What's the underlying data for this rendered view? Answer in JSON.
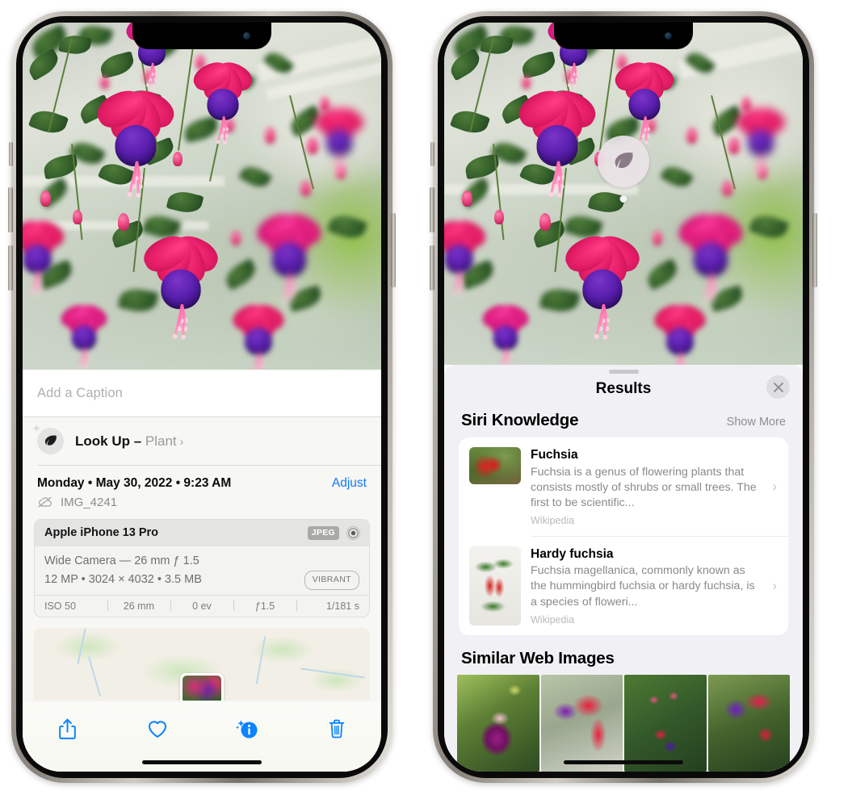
{
  "left_phone": {
    "name": "iphone-photo-info",
    "photo_alt": "Fuchsia flowers hanging basket",
    "caption": {
      "placeholder": "Add a Caption",
      "value": ""
    },
    "lookup": {
      "icon": "leaf-icon",
      "sparkle_icon": "sparkle-icon",
      "label": "Look Up",
      "dash": " – ",
      "subject": "Plant",
      "chevron": "›"
    },
    "date": {
      "text": "Monday • May 30, 2022 • 9:23 AM",
      "adjust_label": "Adjust"
    },
    "file": {
      "cloud_icon": "cloud-slash-icon",
      "name": "IMG_4241"
    },
    "exif": {
      "device": "Apple iPhone 13 Pro",
      "format_badge": "JPEG",
      "aperture_icon": "aperture-icon",
      "lens_line": "Wide Camera — 26 mm ƒ 1.5",
      "size_line": "12 MP • 3024 × 4032 • 3.5 MB",
      "quality_chip": "VIBRANT",
      "stats": [
        "ISO 50",
        "26 mm",
        "0 ev",
        "ƒ1.5",
        "1/181 s"
      ]
    },
    "map": {
      "name": "location-map",
      "pin": "photo-pin"
    },
    "toolbar": [
      {
        "name": "share-button",
        "icon": "share-icon"
      },
      {
        "name": "favorite-button",
        "icon": "heart-icon"
      },
      {
        "name": "info-button",
        "icon": "info-sparkle-icon"
      },
      {
        "name": "delete-button",
        "icon": "trash-icon"
      }
    ]
  },
  "right_phone": {
    "name": "iphone-visual-lookup-results",
    "visual_lookup_badge": {
      "icon": "leaf-icon"
    },
    "sheet": {
      "title": "Results",
      "close_icon": "close-icon",
      "siri_section": {
        "title": "Siri Knowledge",
        "show_more": "Show More",
        "cards": [
          {
            "title": "Fuchsia",
            "description": "Fuchsia is a genus of flowering plants that consists mostly of shrubs or small trees. The first to be scientific...",
            "source": "Wikipedia",
            "chevron": "›",
            "thumb": "fuchsia-red-flowers"
          },
          {
            "title": "Hardy fuchsia",
            "description": "Fuchsia magellanica, commonly known as the hummingbird fuchsia or hardy fuchsia, is a species of floweri...",
            "source": "Wikipedia",
            "chevron": "›",
            "thumb": "hardy-fuchsia-specimen"
          }
        ]
      },
      "web_section": {
        "title": "Similar Web Images",
        "thumbnails": [
          {
            "name": "web-image-1",
            "alt": "pink and magenta fuchsia with leaves"
          },
          {
            "name": "web-image-2",
            "alt": "red and purple fuchsia closeup"
          },
          {
            "name": "web-image-3",
            "alt": "fuchsia bush with many buds"
          },
          {
            "name": "web-image-4",
            "alt": "purple and red double fuchsia"
          }
        ]
      }
    }
  },
  "colors": {
    "accent_blue": "#1277ff",
    "sheet_bg": "#f1f1f5",
    "info_bg": "#f7f7f4",
    "card_bg": "#ffffff",
    "muted_text": "#8a8a8f"
  }
}
